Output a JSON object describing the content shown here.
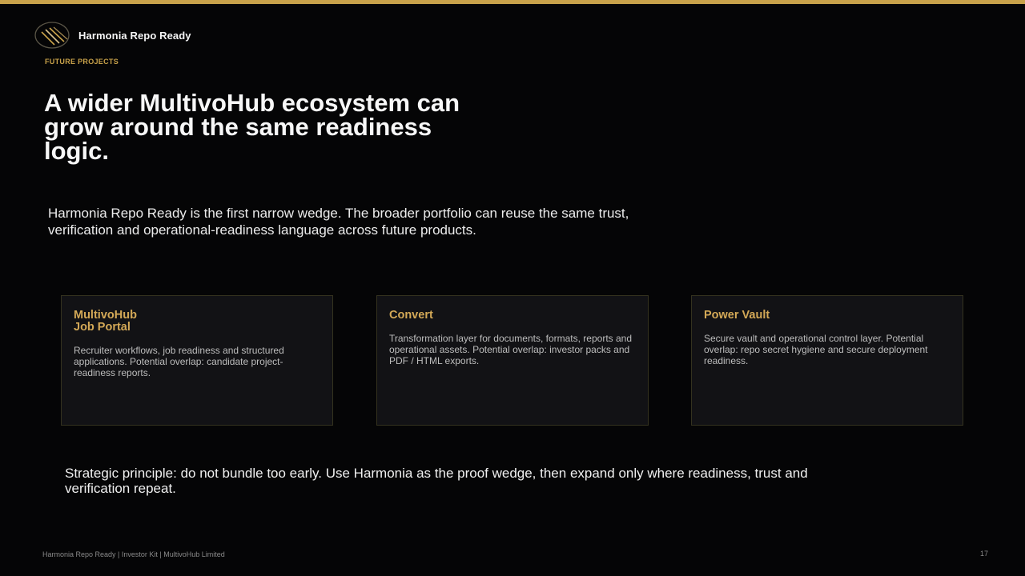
{
  "brand": {
    "name": "Harmonia Repo Ready",
    "logo_icon": "harmonia-logo-icon"
  },
  "colors": {
    "accent": "#c9a24a",
    "background": "#050506",
    "card_background": "#121215"
  },
  "kicker": "FUTURE PROJECTS",
  "title": "A wider MultivoHub ecosystem can grow around the same readiness logic.",
  "lead": "Harmonia Repo Ready is the first narrow wedge. The broader portfolio can reuse the same trust, verification and operational-readiness language across future products.",
  "cards": [
    {
      "title": "MultivoHub\nJob Portal",
      "description": "Recruiter workflows, job readiness and structured applications. Potential overlap: candidate project-readiness reports."
    },
    {
      "title": "Convert",
      "description": "Transformation layer for documents, formats, reports and operational assets. Potential overlap: investor packs and PDF / HTML exports."
    },
    {
      "title": "Power Vault",
      "description": "Secure vault and operational control layer. Potential overlap: repo secret hygiene and secure deployment readiness."
    }
  ],
  "principle": "Strategic principle: do not bundle too early. Use Harmonia as the proof wedge, then expand only where readiness, trust and verification repeat.",
  "footer": {
    "left": "Harmonia Repo Ready | Investor Kit | MultivoHub Limited",
    "page_number": "17"
  }
}
